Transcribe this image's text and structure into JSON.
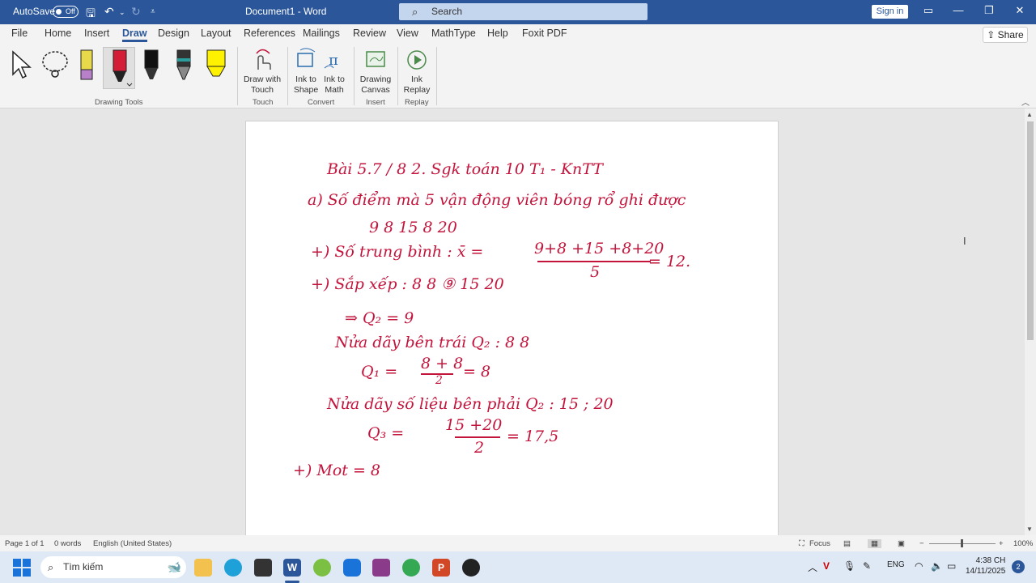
{
  "titlebar": {
    "autosave_label": "AutoSave",
    "autosave_state": "Off",
    "doc_title": "Document1  -  Word",
    "search_placeholder": "Search",
    "signin_label": "Sign in",
    "accent": "#2b579a"
  },
  "menu": {
    "tabs": [
      "File",
      "Home",
      "Insert",
      "Draw",
      "Design",
      "Layout",
      "References",
      "Mailings",
      "Review",
      "View",
      "MathType",
      "Help",
      "Foxit PDF"
    ],
    "active_tab": "Draw",
    "share_label": "Share"
  },
  "ribbon": {
    "groups": {
      "drawing_tools": "Drawing Tools",
      "touch": "Touch",
      "convert": "Convert",
      "insert": "Insert",
      "replay": "Replay"
    },
    "buttons": {
      "draw_touch": [
        "Draw with",
        "Touch"
      ],
      "ink_shape": [
        "Ink to",
        "Shape"
      ],
      "ink_math": [
        "Ink to",
        "Math"
      ],
      "drawing_canvas": [
        "Drawing",
        "Canvas"
      ],
      "ink_replay": [
        "Ink",
        "Replay"
      ]
    },
    "pen_colors": [
      "#e8d94a",
      "#d41d36",
      "#111111",
      "#333333",
      "#fff200"
    ]
  },
  "document": {
    "ink_lines": {
      "l1": "Bài 5.7 / 8 2.   Sgk toán 10 T₁ - KnTT",
      "l2": "a)  Số điểm mà 5 vận động viên bóng rổ ghi được",
      "l3": "9     8    15    8    20",
      "l4a": "+)  Số trung bình :   x̄   =",
      "l4b": "9+8 +15 +8+20",
      "l4c": "5",
      "l4d": "=  12.",
      "l5": "+)   Sắp xếp  :    8    8    ⑨   15   20",
      "l6": "⇒  Q₂  = 9",
      "l7": "Nửa dãy bên trái Q₂ :   8    8",
      "l8a": "Q₁  =",
      "l8b": "8 + 8",
      "l8c": "2",
      "l8d": "=  8",
      "l9": "Nửa dãy số liệu bên phải Q₂ :    15 ; 20",
      "l10a": "Q₃   =",
      "l10b": "15 +20",
      "l10c": "2",
      "l10d": "=  17,5",
      "l11": "+)  Mot  = 8"
    },
    "ink_color": "#c3143c"
  },
  "statusbar": {
    "page": "Page 1 of 1",
    "words": "0 words",
    "language": "English (United States)",
    "focus": "Focus",
    "zoom": "100%"
  },
  "taskbar": {
    "search_placeholder": "Tìm kiếm",
    "lang": "ENG",
    "time": "4:38 CH",
    "date": "14/11/2025",
    "notifications": "2"
  }
}
